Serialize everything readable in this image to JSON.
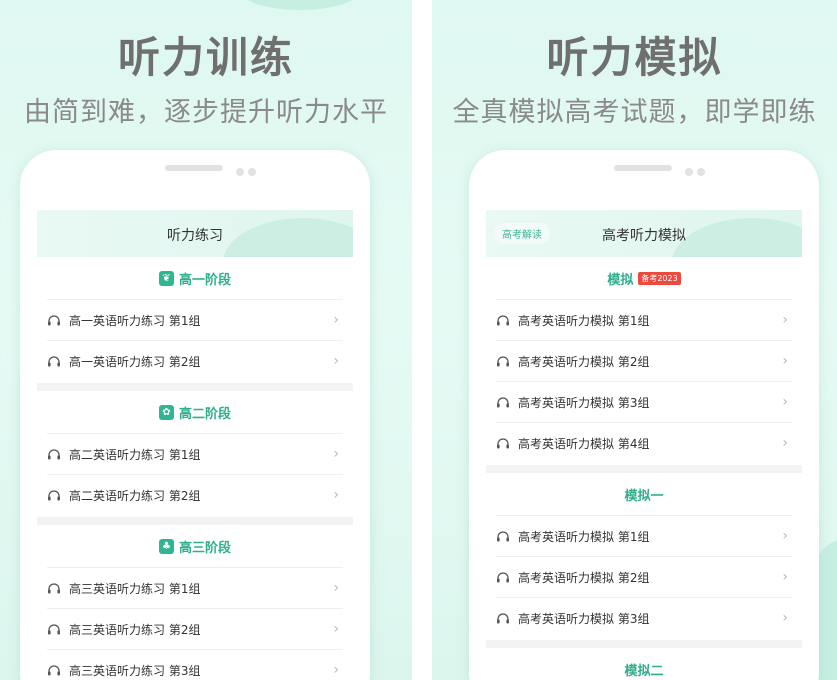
{
  "left": {
    "headline": "听力训练",
    "subline": "由简到难，逐步提升听力水平",
    "screen_title": "听力练习",
    "sections": [
      {
        "title": "高一阶段",
        "icon": "sprout-icon",
        "items": [
          "高一英语听力练习 第1组",
          "高一英语听力练习 第2组"
        ]
      },
      {
        "title": "高二阶段",
        "icon": "plant-icon",
        "items": [
          "高二英语听力练习 第1组",
          "高二英语听力练习 第2组"
        ]
      },
      {
        "title": "高三阶段",
        "icon": "tree-icon",
        "items": [
          "高三英语听力练习 第1组",
          "高三英语听力练习 第2组",
          "高三英语听力练习 第3组"
        ]
      }
    ]
  },
  "right": {
    "headline": "听力模拟",
    "subline": "全真模拟高考试题，即学即练",
    "screen_title": "高考听力模拟",
    "tag": "高考解读",
    "sections": [
      {
        "title": "模拟",
        "badge": "备考2023",
        "items": [
          "高考英语听力模拟 第1组",
          "高考英语听力模拟 第2组",
          "高考英语听力模拟 第3组",
          "高考英语听力模拟 第4组"
        ]
      },
      {
        "title": "模拟一",
        "items": [
          "高考英语听力模拟 第1组",
          "高考英语听力模拟 第2组",
          "高考英语听力模拟 第3组"
        ]
      },
      {
        "title": "模拟二",
        "items": []
      }
    ]
  },
  "icons": {
    "item": "headphones-icon",
    "chevron": "chevron-right-icon"
  },
  "colors": {
    "accent": "#2fae8e",
    "badge": "#ec4a3f",
    "background": "#dff8f1"
  }
}
